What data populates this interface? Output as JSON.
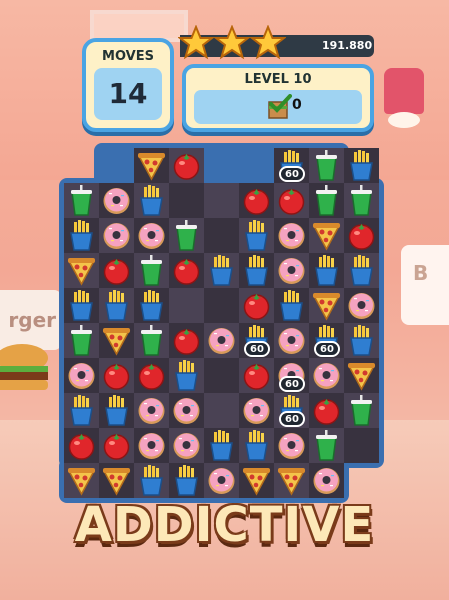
{
  "hud": {
    "moves_label": "MOVES",
    "moves_value": "14",
    "score": "191.880",
    "stars_earned": 3,
    "level_label": "LEVEL 10",
    "goal_count": "0",
    "goal_icon": "crate-checkmark-icon"
  },
  "background": {
    "left_sign_text": "rger",
    "right_sign_text": "B"
  },
  "board": {
    "colors": {
      "frame": "#3a6fb0",
      "dark": "#38323f",
      "light": "#4a4254"
    },
    "grid": [
      [
        null,
        "pizza",
        "tomato",
        "soda",
        null,
        "fries",
        "soda",
        "fries"
      ],
      [
        "soda",
        "donut",
        "fries",
        "tile",
        "tile",
        "tomato",
        "tomato",
        "soda",
        "soda"
      ],
      [
        "fries",
        "donut",
        "donut",
        "soda",
        "tile",
        "fries",
        "donut",
        "pizza",
        "tomato"
      ],
      [
        "pizza",
        "tomato",
        "soda",
        "tomato",
        "fries",
        "fries",
        "donut",
        "fries",
        "fries"
      ],
      [
        "fries",
        "fries",
        "fries",
        "tile",
        "tile",
        "tomato",
        "fries",
        "pizza",
        "donut"
      ],
      [
        "soda",
        "pizza",
        "soda",
        "tomato",
        "donut",
        "fries",
        "donut",
        "fries",
        "fries"
      ],
      [
        "donut",
        "tomato",
        "tomato",
        "fries",
        "tile",
        "tomato",
        "donut",
        "donut",
        "pizza"
      ],
      [
        "fries",
        "fries",
        "donut",
        "donut",
        "tile",
        "donut",
        "fries",
        "tomato",
        "soda"
      ],
      [
        "tomato",
        "tomato",
        "donut",
        "donut",
        "fries",
        "fries",
        "donut",
        "soda",
        "tile"
      ],
      [
        "pizza",
        "pizza",
        "fries",
        "fries",
        "donut",
        "pizza",
        "pizza",
        "donut",
        null
      ]
    ],
    "badges": [
      {
        "row": 0,
        "col": 6,
        "text": "60"
      },
      {
        "row": 5,
        "col": 5,
        "text": "60"
      },
      {
        "row": 5,
        "col": 7,
        "text": "60"
      },
      {
        "row": 6,
        "col": 6,
        "text": "60"
      },
      {
        "row": 7,
        "col": 6,
        "text": "60"
      }
    ]
  },
  "banner": {
    "title": "ADDICTIVE"
  }
}
